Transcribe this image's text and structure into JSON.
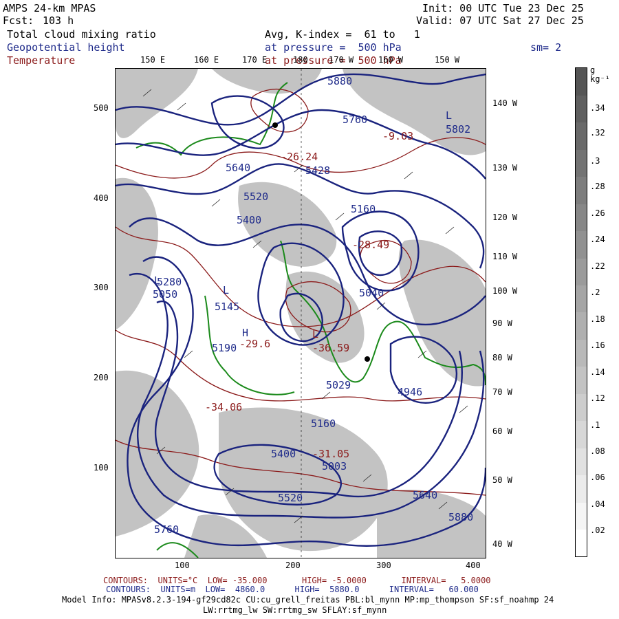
{
  "header": {
    "model": "AMPS 24-km MPAS",
    "forecast_label": "Fcst:",
    "forecast_value": "103 h",
    "init": "Init: 00 UTC Tue 23 Dec 25",
    "valid": "Valid: 07 UTC Sat 27 Dec 25",
    "field1": "Total cloud mixing ratio",
    "field2": "Geopotential height",
    "field3": "Temperature",
    "avg": "Avg, K-index =  61 to   1",
    "pressure2": "at pressure =  500 hPa",
    "pressure3": "at pressure =  500 hPa",
    "smoothing": "sm= 2"
  },
  "axes": {
    "y_ticks": [
      "500",
      "400",
      "300",
      "200",
      "100"
    ],
    "x_ticks": [
      "100",
      "200",
      "300",
      "400"
    ],
    "top_lon_labels": [
      "150 E",
      "160 E",
      "170 E",
      "180",
      "170 W",
      "160 W",
      "150 W"
    ],
    "right_lon_labels": [
      "140 W",
      "130 W",
      "120 W",
      "110 W",
      "100 W",
      "90 W",
      "80 W",
      "70 W",
      "60 W",
      "50 W",
      "40 W"
    ]
  },
  "map_labels": {
    "heights": [
      "5880",
      "5760",
      "5640",
      "5520",
      "5400",
      "5280",
      "5160",
      "5040",
      "5145",
      "5190",
      "5029",
      "5003",
      "5050",
      "4946",
      "5802",
      "5428",
      "5160",
      "5400",
      "5520",
      "5640",
      "5760",
      "5880"
    ],
    "temperatures": [
      "-26.24",
      "-28.49",
      "-29.6",
      "-36.59",
      "-31.05",
      "-9.03",
      "-34.06"
    ],
    "markers": [
      "H",
      "L"
    ]
  },
  "colorbar": {
    "units": "g kg⁻¹",
    "labels": [
      ".34",
      ".32",
      ".3",
      ".28",
      ".26",
      ".24",
      ".22",
      ".2",
      ".18",
      ".16",
      ".14",
      ".12",
      ".1",
      ".08",
      ".06",
      ".04",
      ".02"
    ]
  },
  "footer": {
    "temp_contours": "CONTOURS:  UNITS=°C  LOW= -35.000       HIGH= -5.0000       INTERVAL=   5.0000",
    "height_contours": "CONTOURS:  UNITS=m  LOW=  4860.0      HIGH=  5880.0      INTERVAL=   60.000",
    "model_info": "Model Info: MPASv8.2.3-194-gf29cd82c CU:cu_grell_freitas PBL:bl_mynn MP:mp_thompson SF:sf_noahmp 24",
    "model_info2": "LW:rrtmg_lw SW:rrtmg_sw SFLAY:sf_mynn"
  },
  "colors": {
    "height_contour": "#1a237e",
    "temperature_contour": "#8b1a1a",
    "coastline": "#1b8a1b",
    "cloud_shading": "#b0b0b0"
  }
}
